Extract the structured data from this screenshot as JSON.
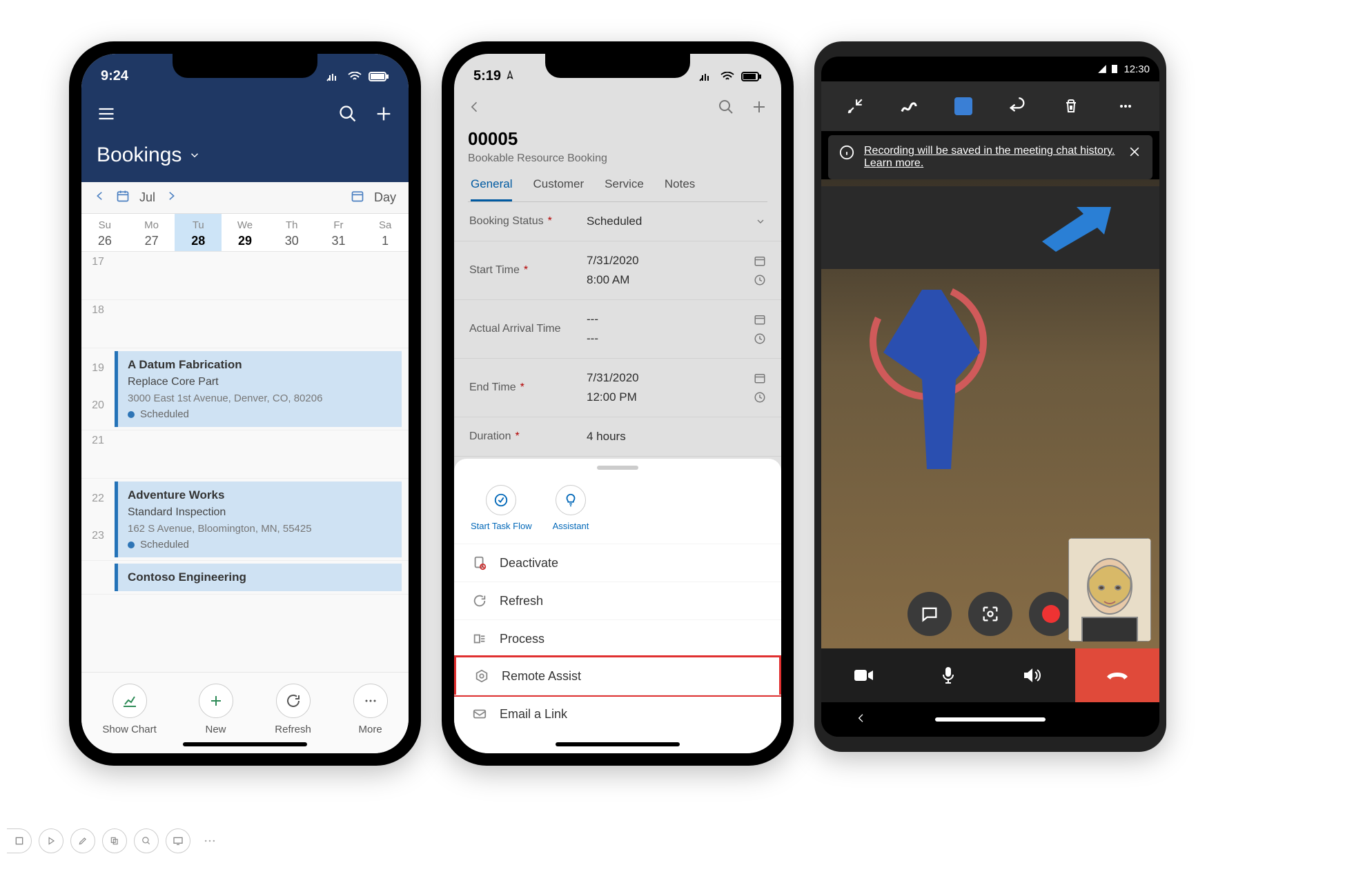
{
  "phone1": {
    "status_time": "9:24",
    "header_title": "Bookings",
    "month": "Jul",
    "view": "Day",
    "weekdays": [
      "Su",
      "Mo",
      "Tu",
      "We",
      "Th",
      "Fr",
      "Sa"
    ],
    "dates": [
      "26",
      "27",
      "28",
      "29",
      "30",
      "31",
      "1"
    ],
    "hours": [
      "17",
      "18",
      "19",
      "20",
      "21",
      "22",
      "23"
    ],
    "events": [
      {
        "title": "A Datum Fabrication",
        "sub": "Replace Core Part",
        "addr": "3000 East 1st Avenue, Denver, CO, 80206",
        "status": "Scheduled"
      },
      {
        "title": "Adventure Works",
        "sub": "Standard Inspection",
        "addr": "162 S Avenue, Bloomington, MN, 55425",
        "status": "Scheduled"
      },
      {
        "title": "Contoso Engineering"
      }
    ],
    "bottom": {
      "chart": "Show Chart",
      "new": "New",
      "refresh": "Refresh",
      "more": "More"
    }
  },
  "phone2": {
    "status_time": "5:19",
    "title": "00005",
    "subtitle": "Bookable Resource Booking",
    "tabs": [
      "General",
      "Customer",
      "Service",
      "Notes"
    ],
    "fields": {
      "booking_status": {
        "label": "Booking Status",
        "value": "Scheduled"
      },
      "start_time": {
        "label": "Start Time",
        "date": "7/31/2020",
        "time": "8:00 AM"
      },
      "arrival": {
        "label": "Actual Arrival Time",
        "date": "---",
        "time": "---"
      },
      "end_time": {
        "label": "End Time",
        "date": "7/31/2020",
        "time": "12:00 PM"
      },
      "duration": {
        "label": "Duration",
        "value": "4 hours"
      }
    },
    "sheet": {
      "task_flow": "Start Task Flow",
      "assistant": "Assistant",
      "items": [
        "Deactivate",
        "Refresh",
        "Process",
        "Remote Assist",
        "Email a Link"
      ]
    }
  },
  "phone3": {
    "status_time": "12:30",
    "banner_text": "Recording will be saved in the meeting chat history.",
    "banner_link": "Learn more."
  }
}
